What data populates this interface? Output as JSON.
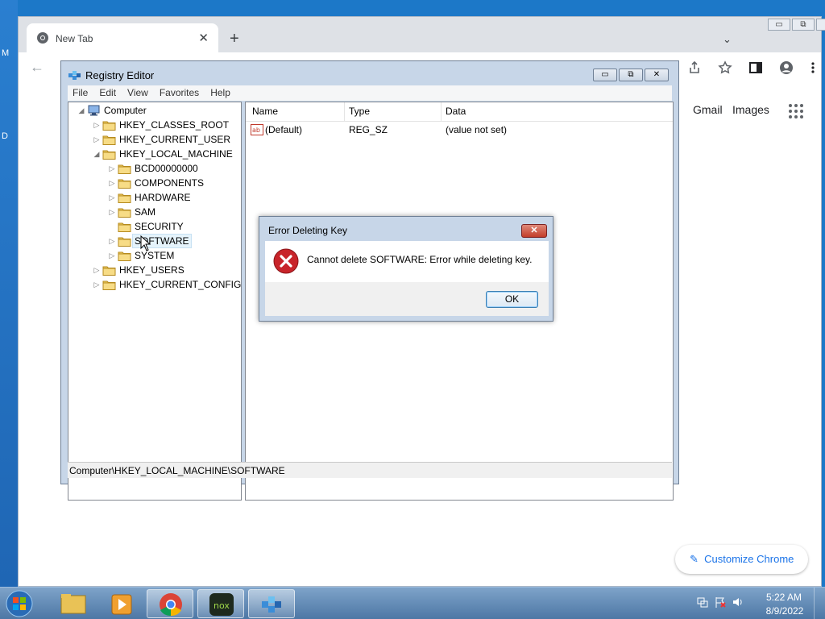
{
  "desktop": {
    "side_letters": [
      "M",
      "D"
    ]
  },
  "chrome": {
    "tab_title": "New Tab",
    "tab_close": "✕",
    "new_tab": "+",
    "tab_list": "⌄",
    "window_controls": [
      "▭",
      "⧉",
      "✕"
    ],
    "back": "←",
    "toolbar_icons": [
      "share-icon",
      "star-icon",
      "sidebar-icon",
      "profile-icon",
      "kebab-menu-icon"
    ],
    "gmail": "Gmail",
    "images": "Images",
    "customize": "Customize Chrome",
    "accent": "#1a73e8"
  },
  "registry": {
    "title": "Registry Editor",
    "window_controls": [
      "▭",
      "⧉",
      "✕"
    ],
    "menu": [
      "File",
      "Edit",
      "View",
      "Favorites",
      "Help"
    ],
    "tree": [
      {
        "label": "Computer",
        "level": 0,
        "exp": "◢",
        "icon": "computer-icon"
      },
      {
        "label": "HKEY_CLASSES_ROOT",
        "level": 1,
        "exp": "▷",
        "icon": "folder-icon"
      },
      {
        "label": "HKEY_CURRENT_USER",
        "level": 1,
        "exp": "▷",
        "icon": "folder-icon"
      },
      {
        "label": "HKEY_LOCAL_MACHINE",
        "level": 1,
        "exp": "◢",
        "icon": "folder-icon"
      },
      {
        "label": "BCD00000000",
        "level": 2,
        "exp": "▷",
        "icon": "folder-icon"
      },
      {
        "label": "COMPONENTS",
        "level": 2,
        "exp": "▷",
        "icon": "folder-icon"
      },
      {
        "label": "HARDWARE",
        "level": 2,
        "exp": "▷",
        "icon": "folder-icon"
      },
      {
        "label": "SAM",
        "level": 2,
        "exp": "▷",
        "icon": "folder-icon"
      },
      {
        "label": "SECURITY",
        "level": 2,
        "exp": "",
        "icon": "folder-icon"
      },
      {
        "label": "SOFTWARE",
        "level": 2,
        "exp": "▷",
        "icon": "folder-icon",
        "selected": true
      },
      {
        "label": "SYSTEM",
        "level": 2,
        "exp": "▷",
        "icon": "folder-icon"
      },
      {
        "label": "HKEY_USERS",
        "level": 1,
        "exp": "▷",
        "icon": "folder-icon"
      },
      {
        "label": "HKEY_CURRENT_CONFIG",
        "level": 1,
        "exp": "▷",
        "icon": "folder-icon"
      }
    ],
    "columns": [
      "Name",
      "Type",
      "Data"
    ],
    "values": [
      {
        "name": "(Default)",
        "type": "REG_SZ",
        "data": "(value not set)",
        "icon": "string-value-icon"
      }
    ],
    "status": "Computer\\HKEY_LOCAL_MACHINE\\SOFTWARE"
  },
  "dialog": {
    "title": "Error Deleting Key",
    "message": "Cannot delete SOFTWARE:  Error while deleting key.",
    "ok": "OK",
    "close": "✕",
    "icon": "error-icon",
    "icon_color": "#c8242a"
  },
  "taskbar": {
    "apps": [
      "windows-explorer-icon",
      "media-player-icon",
      "chrome-icon",
      "nox-player-icon",
      "registry-editor-icon"
    ],
    "nox_label": "nox",
    "time": "5:22 AM",
    "date": "8/9/2022",
    "tray": [
      "network-icon",
      "flag-icon",
      "volume-icon"
    ]
  }
}
